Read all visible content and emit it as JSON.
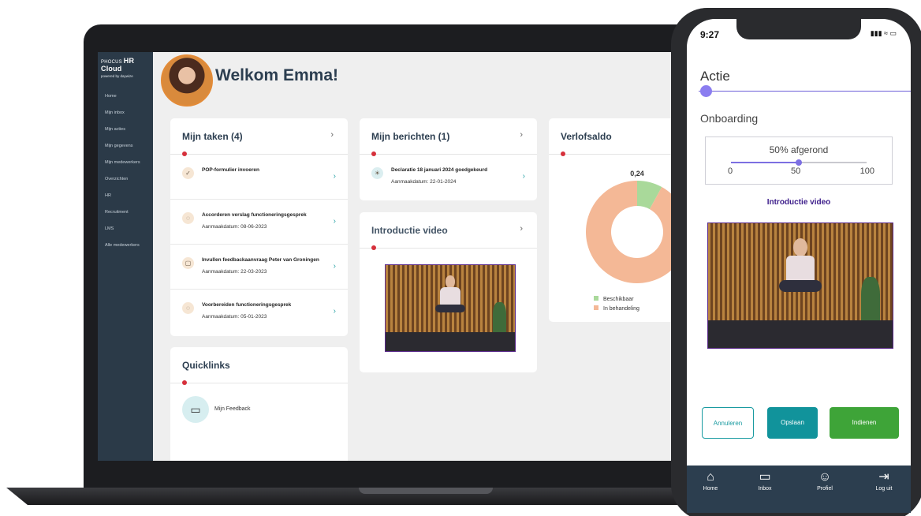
{
  "laptop": {
    "brand": {
      "prefix": "PHOCUS",
      "name": "HR Cloud",
      "powered": "powered by daywize"
    },
    "sidebar": [
      {
        "label": "Home"
      },
      {
        "label": "Mijn inbox"
      },
      {
        "label": "Mijn acties"
      },
      {
        "label": "Mijn gegevens"
      },
      {
        "label": "Mijn medewerkers"
      },
      {
        "label": "Overzichten"
      },
      {
        "label": "HR"
      },
      {
        "label": "Recruitment"
      },
      {
        "label": "LMS"
      },
      {
        "label": "Alle medewerkers"
      }
    ],
    "welcome": "Welkom Emma!",
    "tasks": {
      "title": "Mijn taken (4)",
      "items": [
        {
          "title": "POP-formulier invoeren",
          "date": "",
          "icon": "check-circle-icon"
        },
        {
          "title": "Accorderen verslag functioneringsgesprek",
          "date": "Aanmaakdatum: 08-06-2023",
          "icon": "chat-icon"
        },
        {
          "title": "Invullen feedbackaanvraag Peter van Groningen",
          "date": "Aanmaakdatum: 22-03-2023",
          "icon": "message-icon"
        },
        {
          "title": "Voorbereiden functioneringsgesprek",
          "date": "Aanmaakdatum: 05-01-2023",
          "icon": "chat-icon"
        }
      ]
    },
    "messages": {
      "title": "Mijn berichten (1)",
      "items": [
        {
          "title": "Declaratie 18 januari 2024 goedgekeurd",
          "date": "Aanmaakdatum: 22-01-2024",
          "icon": "lightbulb-icon"
        }
      ]
    },
    "video": {
      "title": "Introductie video"
    },
    "leave": {
      "title": "Verlofsaldo"
    },
    "quicklinks": {
      "title": "Quicklinks",
      "items": [
        {
          "label": "Mijn Feedback",
          "icon": "message-icon"
        }
      ]
    },
    "chevron": "›"
  },
  "chart_data": {
    "type": "pie",
    "title": "Verlofsaldo",
    "value_label": "0,24",
    "series": [
      {
        "name": "Beschikbaar",
        "value": 0.24,
        "color": "#a9d99a"
      },
      {
        "name": "In behandeling",
        "value": 2.76,
        "color": "#f4b896"
      }
    ],
    "legend": "bottom"
  },
  "phone": {
    "time": "9:27",
    "status": "▮▮▮ ≈ ▭",
    "title": "Actie",
    "subtitle": "Onboarding",
    "progress": {
      "label": "50% afgerond",
      "min": "0",
      "value": "50",
      "max": "100",
      "fraction": 0.5
    },
    "video_title": "Introductie video",
    "buttons": {
      "cancel": "Annuleren",
      "save": "Opslaan",
      "submit": "Indienen"
    },
    "tabs": [
      {
        "label": "Home",
        "icon": "home-icon",
        "glyph": "⌂"
      },
      {
        "label": "Inbox",
        "icon": "inbox-icon",
        "glyph": "▭"
      },
      {
        "label": "Profiel",
        "icon": "user-icon",
        "glyph": "☺"
      },
      {
        "label": "Log uit",
        "icon": "logout-icon",
        "glyph": "⇥"
      }
    ]
  },
  "colors": {
    "sidebar": "#2b3a48",
    "accent": "#11939b",
    "submit": "#3ea438",
    "purple": "#7c6fe2"
  }
}
